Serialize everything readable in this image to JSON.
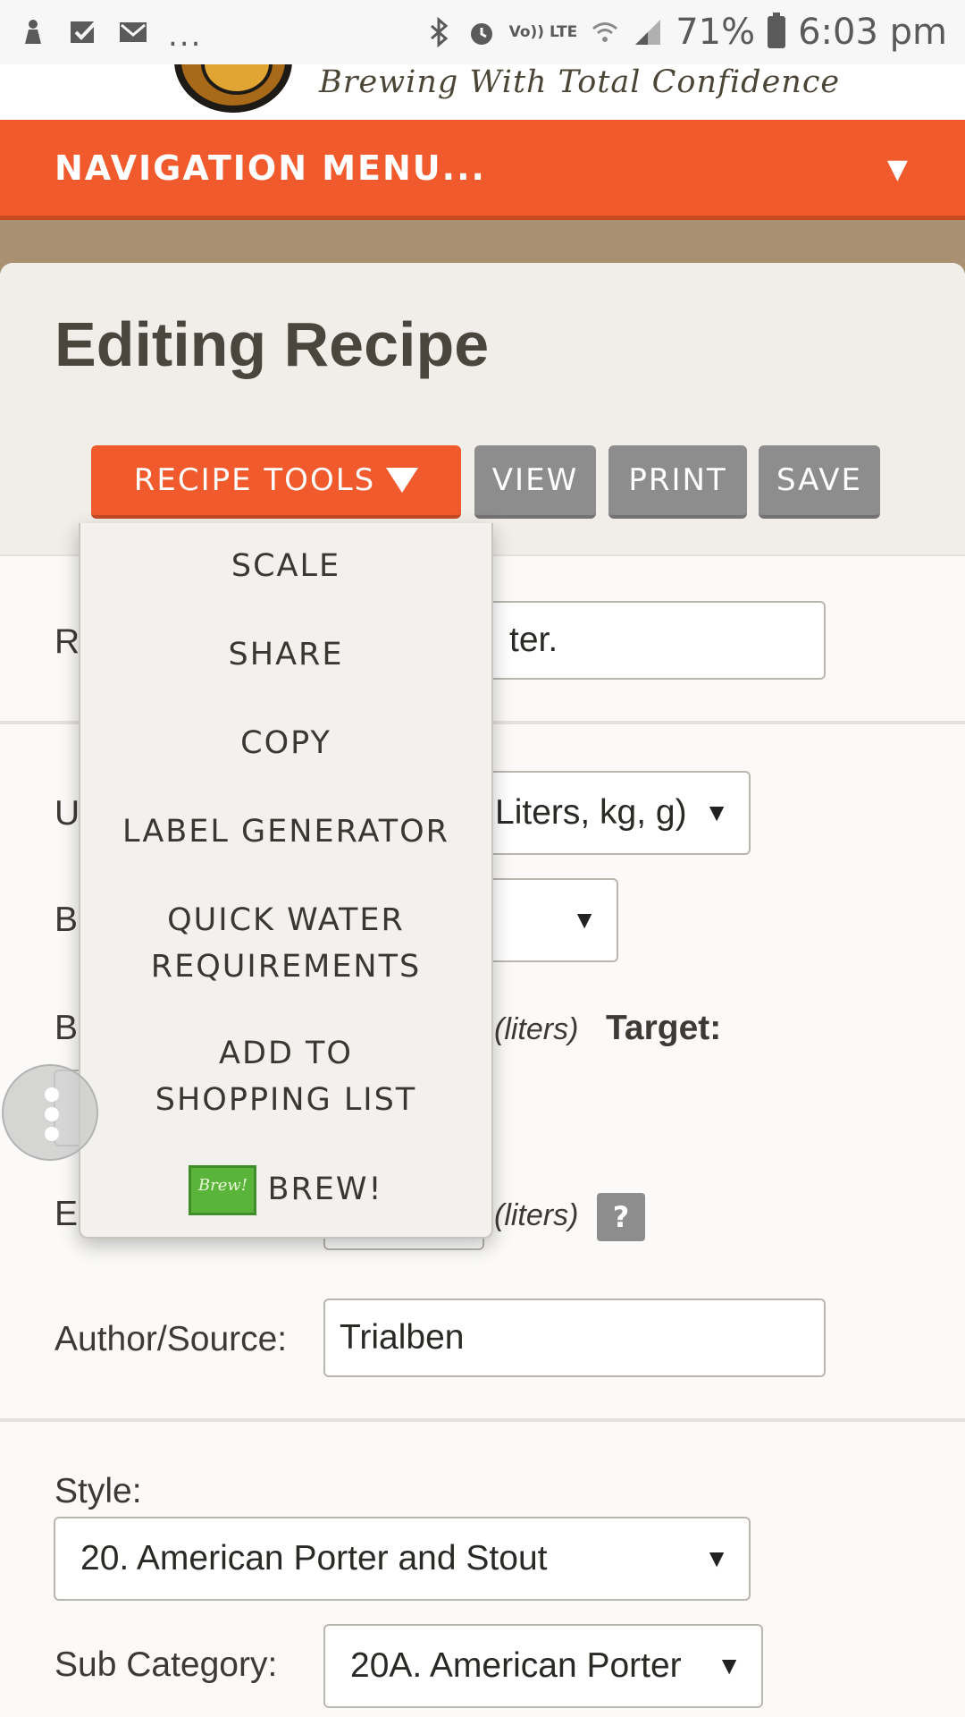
{
  "status_bar": {
    "notification_dots": "...",
    "network": "Vo)) LTE",
    "battery": "71%",
    "time": "6:03 pm",
    "icons": [
      "app-icon",
      "check-icon",
      "mail-icon",
      "bluetooth-icon",
      "alarm-icon",
      "wifi-icon",
      "signal-icon",
      "battery-icon"
    ]
  },
  "header": {
    "tagline": "Brewing With Total Confidence"
  },
  "nav": {
    "label": "NAVIGATION MENU...",
    "caret": "▼"
  },
  "page": {
    "title": "Editing Recipe"
  },
  "toolbar": {
    "tools_label": "RECIPE TOOLS",
    "view_label": "VIEW",
    "print_label": "PRINT",
    "save_label": "SAVE"
  },
  "dropdown": {
    "items": [
      "SCALE",
      "SHARE",
      "COPY",
      "LABEL GENERATOR",
      "QUICK WATER REQUIREMENTS",
      "ADD TO SHOPPING LIST",
      "BREW!"
    ],
    "brew_badge": "Brew!"
  },
  "form": {
    "recipe_name_label_fragment": "R",
    "recipe_name_value_fragment": "ter.",
    "units_label_fragment": "U",
    "units_value_fragment": "Liters, kg, g)",
    "b1_label_fragment": "B",
    "b2_label_fragment": "B",
    "batch_units": "(liters)",
    "target_label": "Target:",
    "e_label_fragment": "E",
    "e_units": "(liters)",
    "help": "?",
    "author_label": "Author/Source:",
    "author_value": "Trialben",
    "style_label": "Style:",
    "style_value": "20. American Porter and Stout",
    "subcat_label": "Sub Category:",
    "subcat_value": "20A. American Porter",
    "select_arrow": "▼"
  },
  "colors": {
    "accent": "#f15a2c",
    "gray_button": "#8d8d8d",
    "tan_band": "#a89070",
    "card_bg": "#f1eee9"
  }
}
